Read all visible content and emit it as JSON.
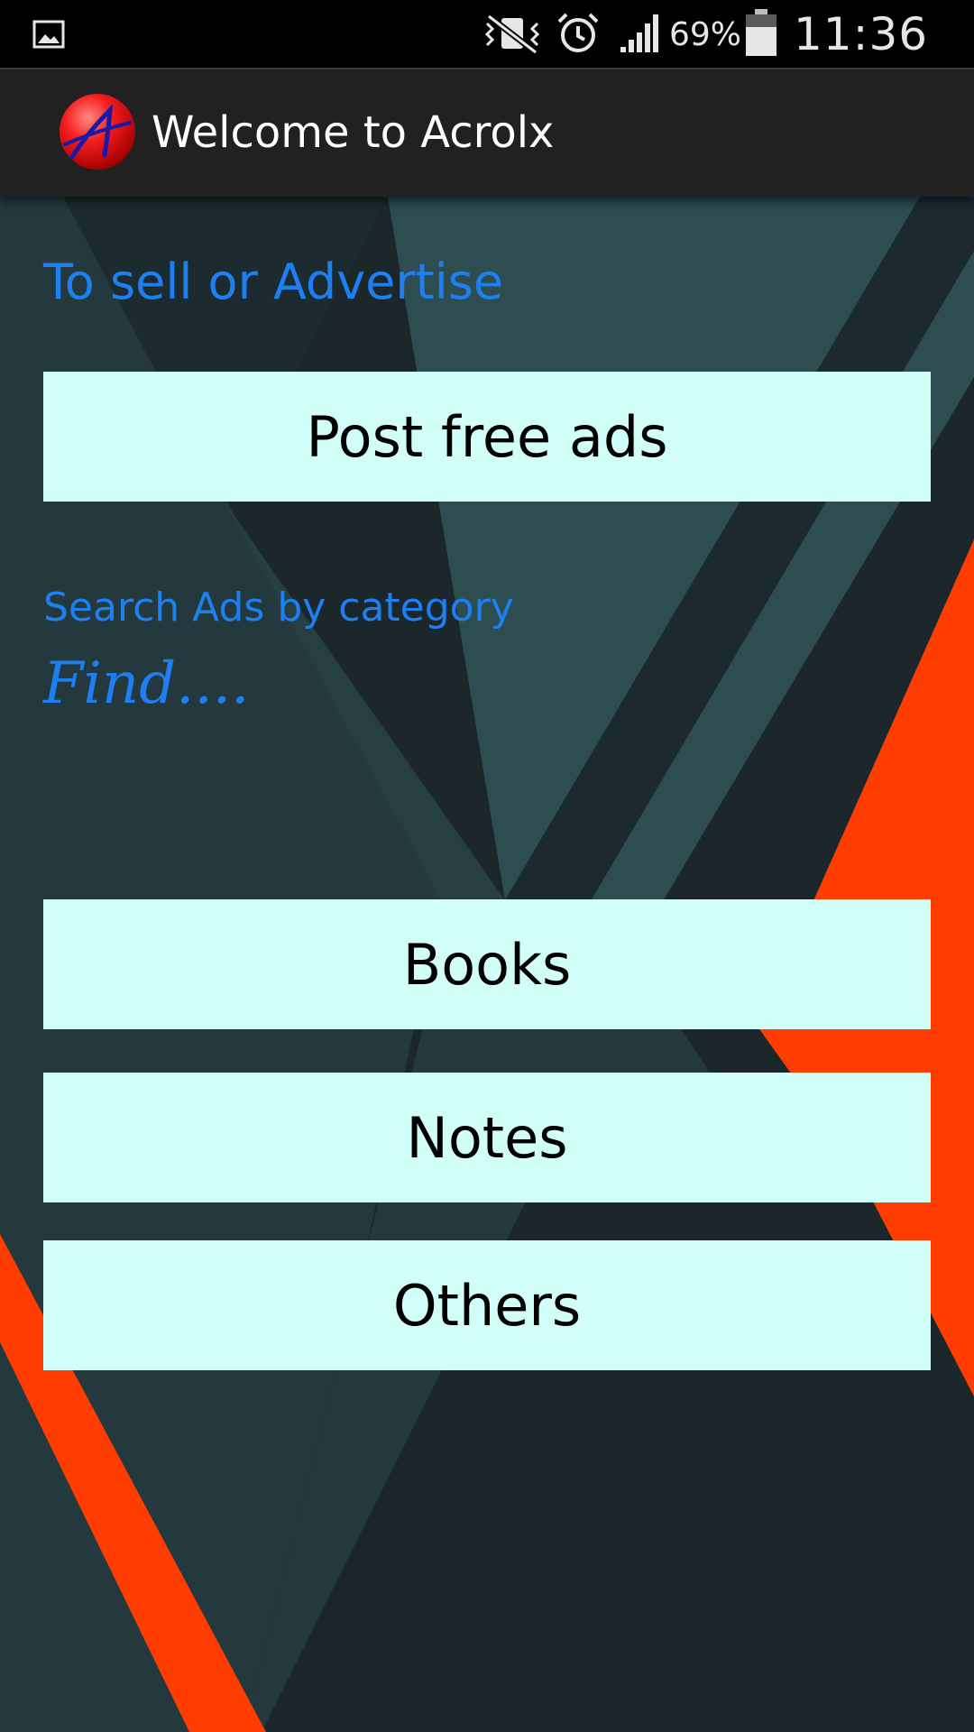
{
  "status_bar": {
    "battery_percent": "69%",
    "time": "11:36 AM",
    "icons": [
      "gallery-icon",
      "mute-vibrate-icon",
      "alarm-icon",
      "signal-icon",
      "battery-icon"
    ]
  },
  "action_bar": {
    "logo_icon": "acrolx-logo",
    "title": "Welcome to Acrolx"
  },
  "main": {
    "sell_label": "To sell or Advertise",
    "post_button": "Post free ads",
    "search_label": "Search Ads by category",
    "find_label": "Find....",
    "categories": [
      "Books",
      "Notes",
      "Others"
    ]
  },
  "colors": {
    "label_blue": "#1e7ff0",
    "button_bg": "#d1fff7",
    "accent_orange": "#ff3d00",
    "bg_dark": "#1b272b",
    "bg_teal": "#2d4d51"
  }
}
